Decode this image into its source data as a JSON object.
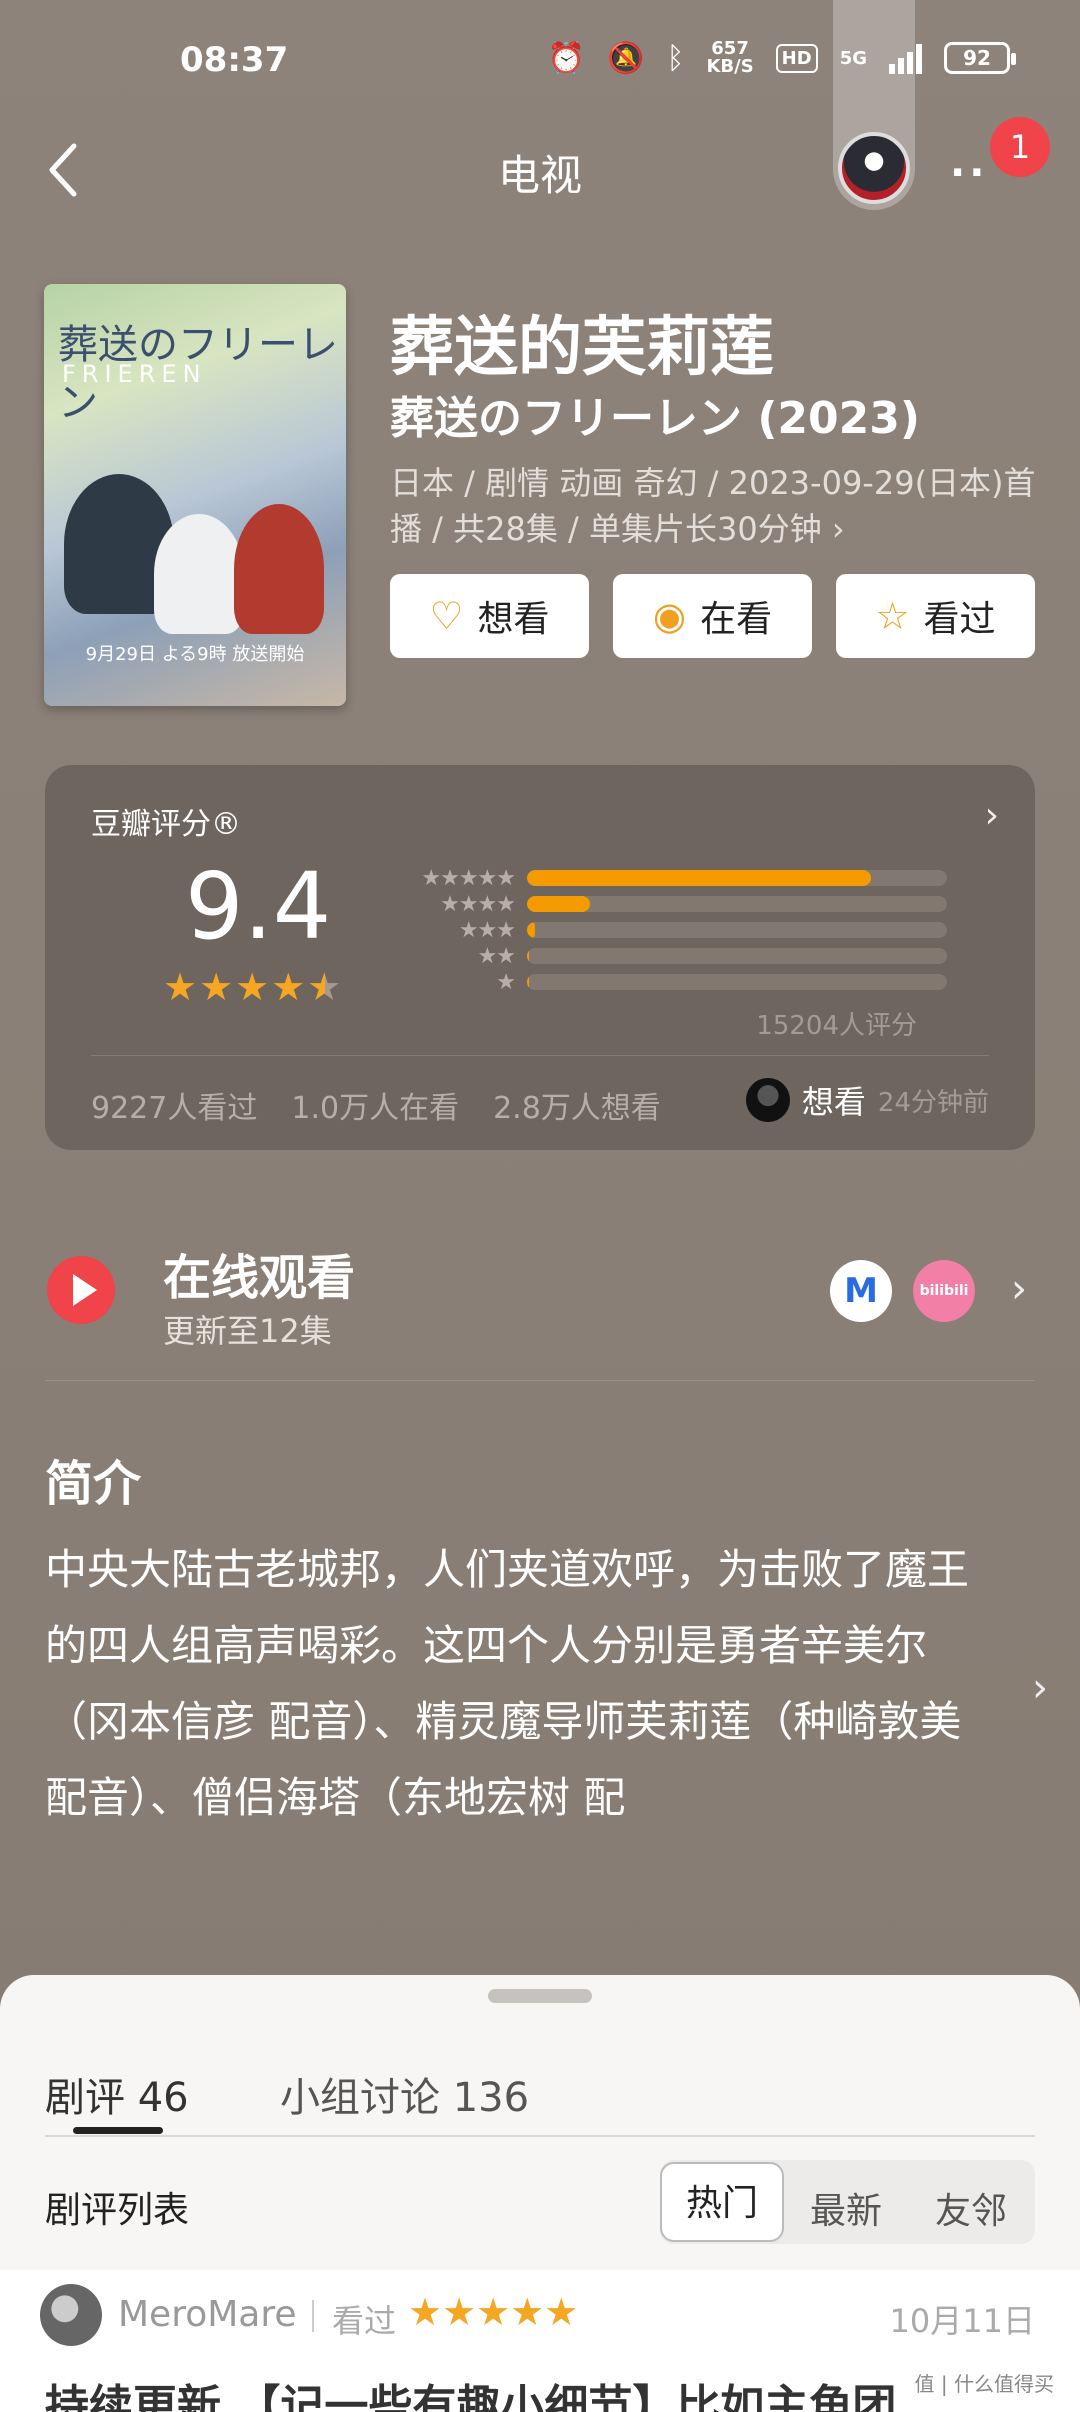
{
  "status_bar": {
    "time": "08:37",
    "net_speed_value": "657",
    "net_speed_unit": "KB/S",
    "hd": "HD",
    "network": "5G",
    "battery": "92"
  },
  "nav": {
    "title": "电视",
    "notification_count": "1"
  },
  "movie": {
    "title_zh": "葬送的芙莉莲",
    "title_original": "葬送のフリーレン (2023)",
    "meta": "日本 / 剧情 动画 奇幻 / 2023-09-29(日本)首播 / 共28集 / 单集片长30分钟 ›",
    "poster_title": "葬送のフリーレン",
    "poster_subtitle": "FRIEREN",
    "poster_date": "9月29日 よる9時 放送開始"
  },
  "actions": {
    "want": "想看",
    "watching": "在看",
    "watched": "看过"
  },
  "rating": {
    "label": "豆瓣评分®",
    "score": "9.4",
    "star_value": 4.5,
    "count": "15204人评分",
    "distribution": [
      {
        "stars": "★★★★★",
        "fraction": 0.82
      },
      {
        "stars": "★★★★",
        "fraction": 0.15
      },
      {
        "stars": "★★★",
        "fraction": 0.02
      },
      {
        "stars": "★★",
        "fraction": 0.005
      },
      {
        "stars": "★",
        "fraction": 0.005
      }
    ],
    "watched_count": "9227人看过",
    "watching_count": "1.0万人在看",
    "want_count": "2.8万人想看",
    "user_status": "想看",
    "user_status_time": "24分钟前"
  },
  "online": {
    "title": "在线观看",
    "subtitle": "更新至12集",
    "platform_1": "M",
    "platform_2": "bilibili"
  },
  "intro": {
    "heading": "简介",
    "text": "中央大陆古老城邦，人们夹道欢呼，为击败了魔王的四人组高声喝彩。这四个人分别是勇者辛美尔（冈本信彦 配音）、精灵魔导师芙莉莲（种崎敦美 配音）、僧侣海塔（东地宏树 配"
  },
  "sheet": {
    "tab_reviews": "剧评 46",
    "tab_groups": "小组讨论 136",
    "list_label": "剧评列表",
    "sort_hot": "热门",
    "sort_new": "最新",
    "sort_friends": "友邻"
  },
  "review": {
    "user": "MeroMare",
    "status": "看过",
    "stars": "★★★★★",
    "date": "10月11日",
    "title": "持续更新 【记一些有趣小细节】比如主角团"
  },
  "watermark": "值 | 什么值得买"
}
